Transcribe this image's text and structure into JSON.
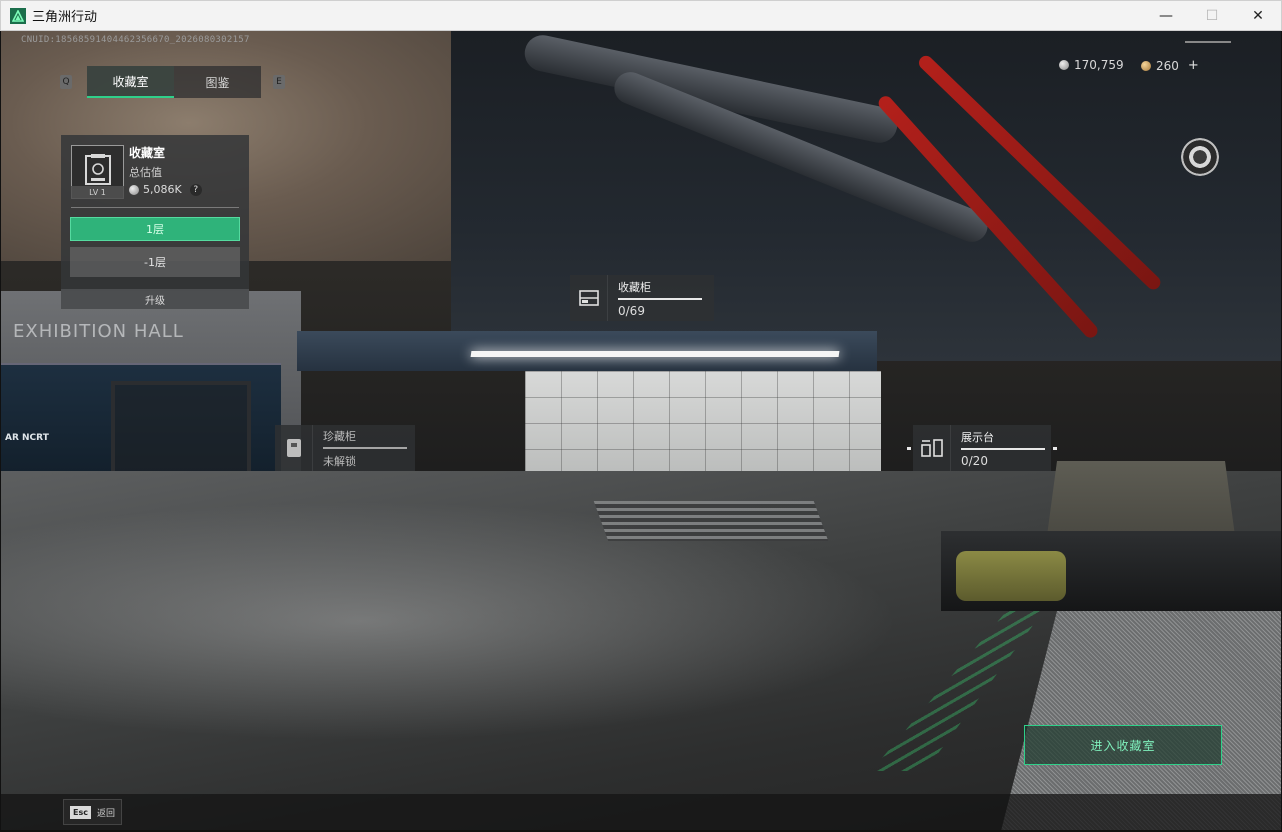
{
  "window": {
    "title": "三角洲行动",
    "controls": {
      "minimize": "—",
      "maximize": "☐",
      "close": "✕"
    }
  },
  "hud": {
    "cnuid": "CNUID:18568591404462356670_2026080302157",
    "nav_prev": "Q",
    "nav_next": "E",
    "tabs": [
      {
        "label": "收藏室",
        "active": true
      },
      {
        "label": "图鉴",
        "active": false
      }
    ],
    "room_panel": {
      "title": "收藏室",
      "level": "LV 1",
      "value_label": "总估值",
      "value": "5,086K",
      "help": "?",
      "floors": [
        "1层",
        "-1层"
      ],
      "upgrade_label": "升级"
    },
    "currency": {
      "silver": "170,759",
      "gold": "260",
      "gold_add": "+"
    },
    "markers": [
      {
        "title": "收藏柜",
        "count": "0/69",
        "icon": "cabinet-icon",
        "locked": false
      },
      {
        "title": "珍藏柜",
        "count": "未解锁",
        "icon": "vault-icon",
        "locked": true
      },
      {
        "title": "展示台",
        "count": "0/20",
        "icon": "display-stand-icon",
        "locked": false
      }
    ],
    "enter_button": "进入收藏室",
    "esc": {
      "key": "Esc",
      "label": "返回"
    }
  },
  "scene": {
    "wall_sign": "EXHIBITION HALL",
    "screen_sign": "AR NCRT"
  },
  "colors": {
    "accent_green": "#2fd08a",
    "floor_active": "#2fb37a",
    "pipe_red": "#b3201b"
  }
}
